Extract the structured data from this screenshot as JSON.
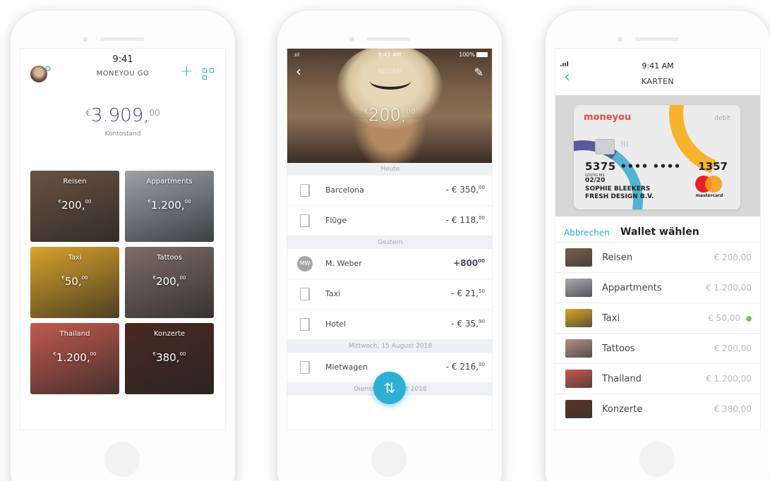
{
  "phone1": {
    "time": "9:41",
    "title": "MONEYOU GO",
    "balance_currency": "€",
    "balance_main": "3.909,",
    "balance_cents": "00",
    "balance_label": "Kontostand",
    "tiles": [
      {
        "name": "Reisen",
        "currency": "€",
        "main": "200,",
        "cents": "00",
        "color": "#6a5240"
      },
      {
        "name": "Appartments",
        "currency": "€",
        "main": "1.200,",
        "cents": "00",
        "color": "#9aa3a8"
      },
      {
        "name": "Taxi",
        "currency": "€",
        "main": "50,",
        "cents": "00",
        "color": "#d9a22a"
      },
      {
        "name": "Tattoos",
        "currency": "€",
        "main": "200,",
        "cents": "00",
        "color": "#7e6c66"
      },
      {
        "name": "Thailand",
        "currency": "€",
        "main": "1.200,",
        "cents": "00",
        "color": "#c25a4e"
      },
      {
        "name": "Konzerte",
        "currency": "€",
        "main": "380,",
        "cents": "00",
        "color": "#4a2a22"
      }
    ]
  },
  "phone2": {
    "status_left": ".ııl",
    "time": "9:41 AM",
    "battery": "100%",
    "title": "REISEN",
    "amount_currency": "€",
    "amount_main": "200,",
    "amount_cents": "00",
    "sections": [
      {
        "label": "Heute",
        "rows": [
          {
            "name": "Barcelona",
            "amount": "- € 350,",
            "cents": "00",
            "kind": "door"
          },
          {
            "name": "Flüge",
            "amount": "- € 118,",
            "cents": "00",
            "kind": "door"
          }
        ]
      },
      {
        "label": "Gestern",
        "rows": [
          {
            "name": "M. Weber",
            "amount": "+800",
            "cents": "00",
            "kind": "avatar",
            "initials": "MW"
          },
          {
            "name": "Taxi",
            "amount": "- € 21,",
            "cents": "50",
            "kind": "door"
          },
          {
            "name": "Hotel",
            "amount": "- € 35,",
            "cents": "90",
            "kind": "door"
          }
        ]
      },
      {
        "label": "Mittwoch, 15 August 2018",
        "rows": [
          {
            "name": "Mietwagen",
            "amount": "- € 216,",
            "cents": "00",
            "kind": "door"
          }
        ]
      },
      {
        "label": "Dienstag, August 2018",
        "rows": []
      }
    ]
  },
  "phone3": {
    "signal": ".ııl",
    "time": "9:41 AM",
    "title": "KARTEN",
    "card": {
      "brand": "moneyou",
      "type": "debit",
      "number_start": "5375 •••• ••••",
      "number_end": "1357",
      "valid_label": "GÜLTIG BIS",
      "expiry": "02/20",
      "holder": "SOPHIE BLEEKERS",
      "company": "FRESH DESIGN B.V.",
      "network": "mastercard"
    },
    "cancel_label": "Abbrechen",
    "choose_label": "Wallet wählen",
    "wallets": [
      {
        "name": "Reisen",
        "value": "€ 200,00",
        "selected": false,
        "color": "#7a5f48"
      },
      {
        "name": "Appartments",
        "value": "€ 1.200,00",
        "selected": false,
        "color": "#a4acb2"
      },
      {
        "name": "Taxi",
        "value": "€ 50,00",
        "selected": true,
        "color": "#d9a22a"
      },
      {
        "name": "Tattoos",
        "value": "€ 200,00",
        "selected": false,
        "color": "#b48e84"
      },
      {
        "name": "Thailand",
        "value": "€ 1.200,00",
        "selected": false,
        "color": "#c7584a"
      },
      {
        "name": "Konzerte",
        "value": "€ 380,00",
        "selected": false,
        "color": "#5a3324"
      }
    ]
  },
  "colors": {
    "accent": "#2bb0d6",
    "balance": "#4a4780",
    "section_bg": "#eef1f3",
    "selected_check": "#7ac943"
  }
}
